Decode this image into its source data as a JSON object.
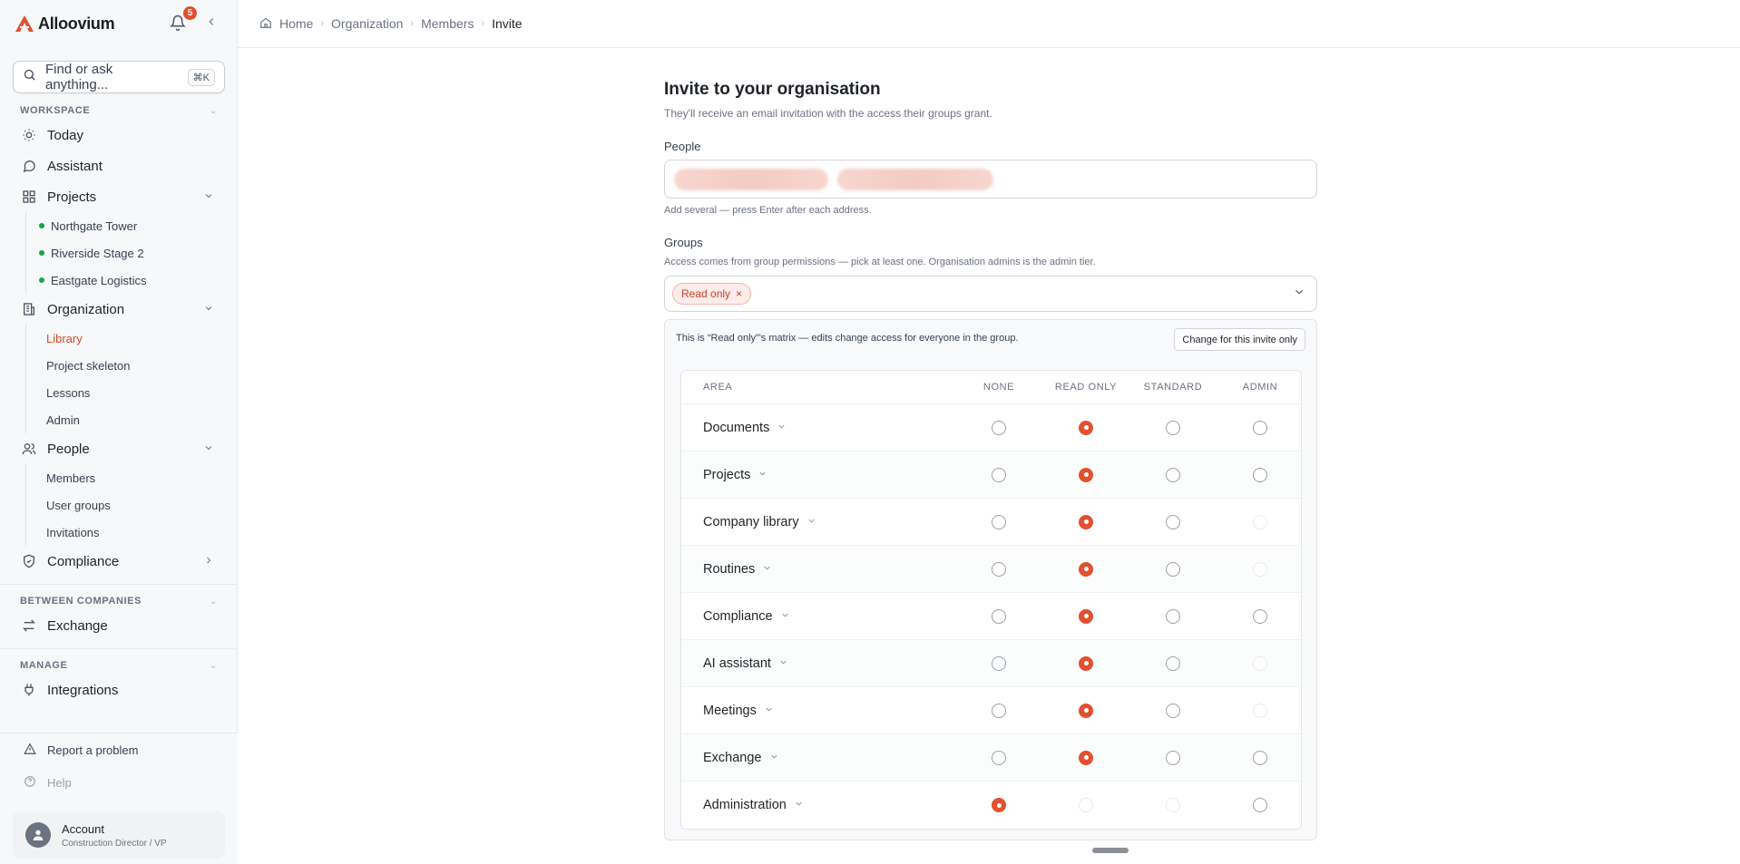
{
  "brand": {
    "name": "Alloovium",
    "accent": "#e2502f"
  },
  "notifications": {
    "count": "5"
  },
  "search": {
    "placeholder": "Find or ask anything...",
    "shortcut": "⌘K"
  },
  "sidebar": {
    "workspace_label": "WORKSPACE",
    "items": {
      "today": "Today",
      "assistant": "Assistant",
      "projects": "Projects",
      "organization": "Organization",
      "people": "People",
      "compliance": "Compliance"
    },
    "projects": [
      "Northgate Tower",
      "Riverside Stage 2",
      "Eastgate Logistics"
    ],
    "organization_sub": [
      "Library",
      "Project skeleton",
      "Lessons",
      "Admin"
    ],
    "people_sub": [
      "Members",
      "User groups",
      "Invitations"
    ],
    "between_label": "BETWEEN COMPANIES",
    "exchange": "Exchange",
    "manage_label": "MANAGE",
    "integrations": "Integrations",
    "report": "Report a problem",
    "help": "Help",
    "account": {
      "name": "Account",
      "role": "Construction Director / VP"
    }
  },
  "breadcrumb": [
    "Home",
    "Organization",
    "Members",
    "Invite"
  ],
  "form": {
    "title": "Invite to your organisation",
    "subtitle": "They'll receive an email invitation with the access their groups grant.",
    "people_label": "People",
    "people_hint": "Add several — press Enter after each address.",
    "groups_label": "Groups",
    "groups_hint": "Access comes from group permissions — pick at least one. Organisation admins is the admin tier.",
    "selected_group": "Read only",
    "matrix_note": "This is “Read only”'s matrix — edits change access for everyone in the group.",
    "change_button": "Change for this invite only"
  },
  "matrix": {
    "columns": [
      "AREA",
      "NONE",
      "READ ONLY",
      "STANDARD",
      "ADMIN"
    ],
    "rows": [
      {
        "area": "Documents",
        "selected": "read_only",
        "admin_available": true
      },
      {
        "area": "Projects",
        "selected": "read_only",
        "admin_available": true
      },
      {
        "area": "Company library",
        "selected": "read_only",
        "admin_available": false
      },
      {
        "area": "Routines",
        "selected": "read_only",
        "admin_available": false
      },
      {
        "area": "Compliance",
        "selected": "read_only",
        "admin_available": true
      },
      {
        "area": "AI assistant",
        "selected": "read_only",
        "admin_available": false
      },
      {
        "area": "Meetings",
        "selected": "read_only",
        "admin_available": false
      },
      {
        "area": "Exchange",
        "selected": "read_only",
        "admin_available": true
      },
      {
        "area": "Administration",
        "selected": "none",
        "admin_available": true
      }
    ]
  }
}
